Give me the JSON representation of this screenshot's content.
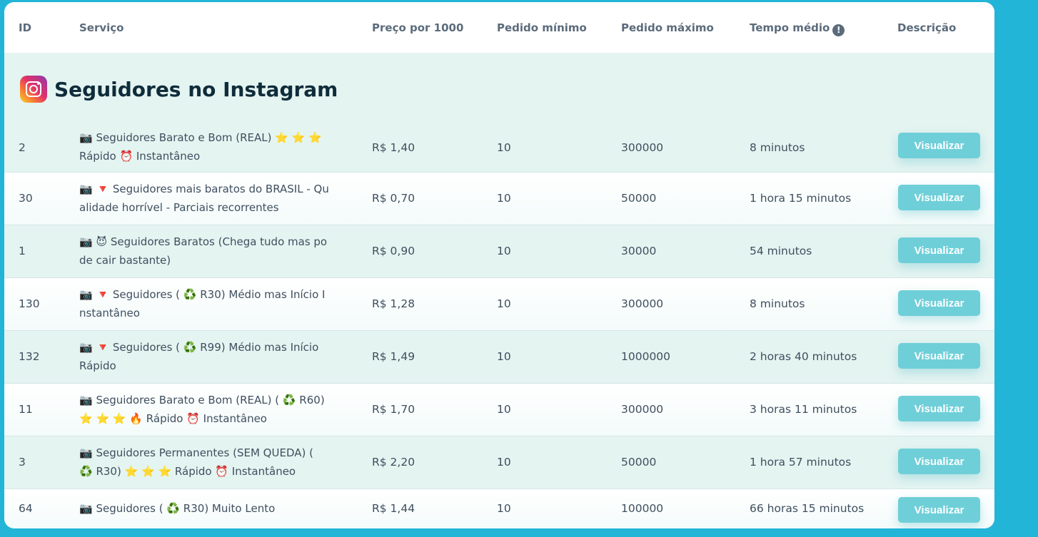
{
  "table": {
    "headers": {
      "id": "ID",
      "service": "Serviço",
      "price": "Preço por 1000",
      "min": "Pedido mínimo",
      "max": "Pedido máximo",
      "time": "Tempo médio",
      "description": "Descrição"
    },
    "category": {
      "title": "Seguidores no Instagram",
      "icon": "instagram-icon"
    },
    "button_label": "Visualizar",
    "rows": [
      {
        "id": "2",
        "service": "📷 Seguidores Barato e Bom (REAL) ⭐ ⭐ ⭐ Rápido ⏰ Instantâneo",
        "price": "R$ 1,40",
        "min": "10",
        "max": "300000",
        "time": "8 minutos"
      },
      {
        "id": "30",
        "service": "📷 🔻 Seguidores mais baratos do BRASIL - Qualidade horrível - Parciais recorrentes",
        "price": "R$ 0,70",
        "min": "10",
        "max": "50000",
        "time": "1 hora 15 minutos"
      },
      {
        "id": "1",
        "service": "📷 😈 Seguidores Baratos (Chega tudo mas pode cair bastante)",
        "price": "R$ 0,90",
        "min": "10",
        "max": "30000",
        "time": "54 minutos"
      },
      {
        "id": "130",
        "service": "📷 🔻 Seguidores ( ♻️ R30) Médio mas Início Instantâneo",
        "price": "R$ 1,28",
        "min": "10",
        "max": "300000",
        "time": "8 minutos"
      },
      {
        "id": "132",
        "service": "📷 🔻 Seguidores ( ♻️ R99) Médio mas Início Rápido",
        "price": "R$ 1,49",
        "min": "10",
        "max": "1000000",
        "time": "2 horas 40 minutos"
      },
      {
        "id": "11",
        "service": "📷 Seguidores Barato e Bom (REAL) ( ♻️ R60) ⭐ ⭐ ⭐ 🔥 Rápido ⏰ Instantâneo",
        "price": "R$ 1,70",
        "min": "10",
        "max": "300000",
        "time": "3 horas 11 minutos"
      },
      {
        "id": "3",
        "service": "📷 Seguidores Permanentes (SEM QUEDA) ( ♻️ R30) ⭐ ⭐ ⭐ Rápido ⏰ Instantâneo",
        "price": "R$ 2,20",
        "min": "10",
        "max": "50000",
        "time": "1 hora 57 minutos"
      },
      {
        "id": "64",
        "service": "📷 Seguidores ( ♻️ R30) Muito Lento",
        "price": "R$ 1,44",
        "min": "10",
        "max": "100000",
        "time": "66 horas 15 minutos"
      }
    ]
  }
}
